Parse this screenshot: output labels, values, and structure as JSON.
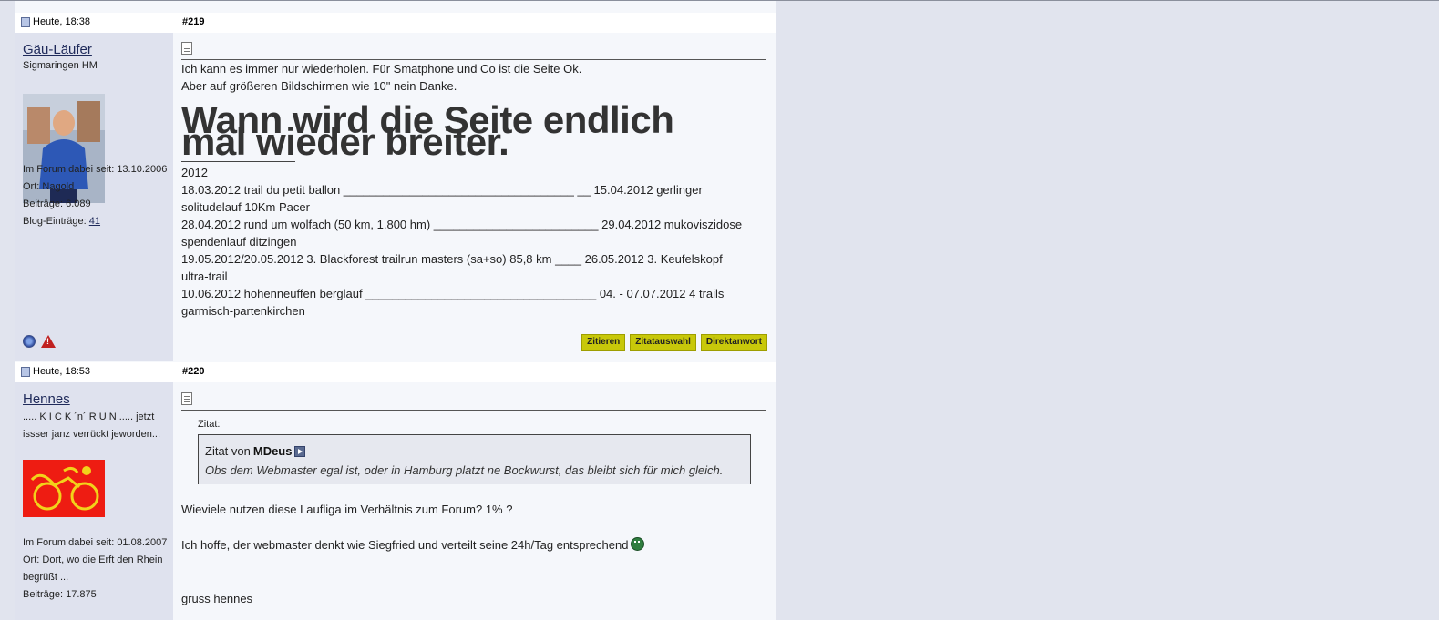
{
  "posts": [
    {
      "date": "Heute, 18:38",
      "number": "#219",
      "user": {
        "name": "Gäu-Läufer",
        "title": "Sigmaringen HM",
        "stats": {
          "joined": "Im Forum dabei seit: 13.10.2006",
          "location": "Ort: Nagold",
          "posts": "Beiträge: 6.089",
          "blog_label": "Blog-Einträge: ",
          "blog_count": "41"
        }
      },
      "content": {
        "line1": "Ich kann es immer nur wiederholen. Für Smatphone und Co ist die Seite Ok.",
        "line2": "Aber auf größeren Bildschirmen wie 10\" nein Danke.",
        "big_line1": "Wann wird die Seite endlich",
        "big_line2": "mal wieder breiter.",
        "signature": [
          "2012",
          "18.03.2012 trail du petit ballon ___________________________________ __ 15.04.2012 gerlinger",
          "solitudelauf 10Km Pacer",
          "28.04.2012 rund um wolfach (50 km, 1.800 hm) _________________________ 29.04.2012 mukoviszidose",
          "spendenlauf ditzingen",
          "19.05.2012/20.05.2012 3. Blackforest trailrun masters (sa+so) 85,8 km ____ 26.05.2012 3. Keufelskopf",
          "ultra-trail",
          "10.06.2012 hohenneuffen berglauf ___________________________________ 04. - 07.07.2012 4 trails",
          "garmisch-partenkirchen"
        ]
      },
      "buttons": {
        "quote": "Zitieren",
        "multi_quote": "Zitatauswahl",
        "direct_reply": "Direktanwort"
      }
    },
    {
      "date": "Heute, 18:53",
      "number": "#220",
      "user": {
        "name": "Hennes",
        "title_line1": "..... K I C K ´n´ R U N ..... jetzt",
        "title_line2": "issser janz verrückt jeworden...",
        "stats": {
          "joined": "Im Forum dabei seit: 01.08.2007",
          "location_line1": "Ort: Dort, wo die Erft den Rhein",
          "location_line2": "begrüßt ...",
          "posts": "Beiträge: 17.875"
        }
      },
      "content": {
        "quote_label": "Zitat:",
        "quote_from_prefix": "Zitat von ",
        "quote_author": "MDeus",
        "quote_text": "Obs dem Webmaster egal ist, oder in Hamburg platzt ne Bockwurst, das bleibt sich für mich gleich.",
        "line1": "Wieviele nutzen diese Laufliga im Verhältnis zum Forum? 1% ?",
        "line2": "Ich hoffe, der webmaster denkt wie Siegfried und verteilt seine 24h/Tag entsprechend",
        "line3": "gruss hennes"
      }
    }
  ]
}
